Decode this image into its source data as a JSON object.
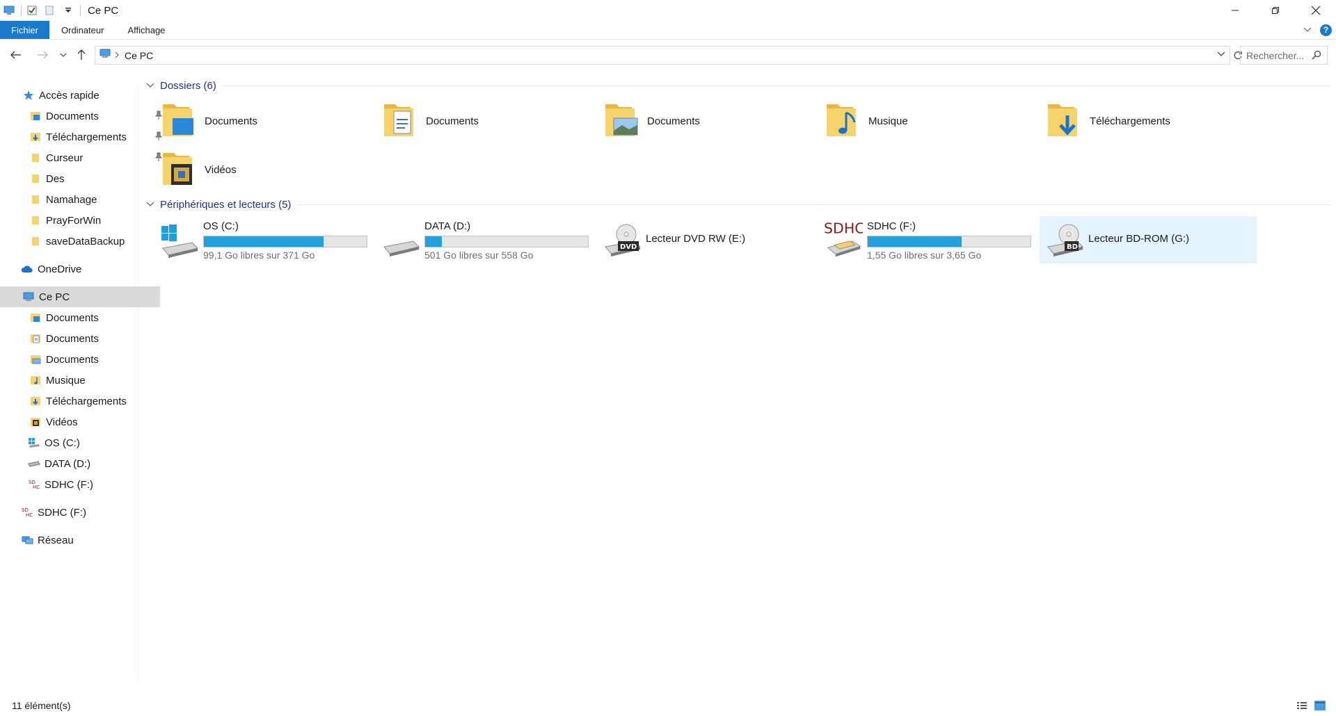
{
  "window": {
    "title": "Ce PC"
  },
  "ribbon": {
    "tabs": [
      {
        "label": "Fichier"
      },
      {
        "label": "Ordinateur"
      },
      {
        "label": "Affichage"
      }
    ],
    "help_label": "?"
  },
  "address": {
    "crumb": "Ce PC"
  },
  "search": {
    "placeholder": "Rechercher..."
  },
  "sidebar": {
    "quick_access": {
      "label": "Accès rapide",
      "items": [
        {
          "label": "Documents",
          "pinned": true
        },
        {
          "label": "Téléchargements",
          "pinned": true
        },
        {
          "label": "Curseur",
          "pinned": true
        },
        {
          "label": "Des",
          "pinned": false
        },
        {
          "label": "Namahage",
          "pinned": false
        },
        {
          "label": "PrayForWin",
          "pinned": false
        },
        {
          "label": "saveDataBackup",
          "pinned": false
        }
      ]
    },
    "onedrive": {
      "label": "OneDrive"
    },
    "this_pc": {
      "label": "Ce PC",
      "items": [
        {
          "label": "Documents"
        },
        {
          "label": "Documents"
        },
        {
          "label": "Documents"
        },
        {
          "label": "Musique"
        },
        {
          "label": "Téléchargements"
        },
        {
          "label": "Vidéos"
        },
        {
          "label": "OS (C:)"
        },
        {
          "label": "DATA (D:)"
        },
        {
          "label": "SDHC (F:)"
        }
      ]
    },
    "sdhc": {
      "label": "SDHC (F:)"
    },
    "network": {
      "label": "Réseau"
    }
  },
  "content": {
    "folders_header": "Dossiers (6)",
    "folders": [
      {
        "label": "Documents",
        "icon": "folder-documents-icon"
      },
      {
        "label": "Documents",
        "icon": "folder-documents-icon"
      },
      {
        "label": "Documents",
        "icon": "folder-pictures-icon"
      },
      {
        "label": "Musique",
        "icon": "folder-music-icon"
      },
      {
        "label": "Téléchargements",
        "icon": "folder-downloads-icon"
      },
      {
        "label": "Vidéos",
        "icon": "folder-videos-icon"
      }
    ],
    "drives_header": "Périphériques et lecteurs (5)",
    "drives": [
      {
        "label": "OS (C:)",
        "free": "99,1 Go libres sur 371 Go",
        "used_fraction": 0.733,
        "bar_color": "#26a0da"
      },
      {
        "label": "DATA (D:)",
        "free": "501 Go libres sur 558 Go",
        "used_fraction": 0.102,
        "bar_color": "#26a0da"
      },
      {
        "label": "Lecteur DVD RW (E:)",
        "icon_text": "DVD"
      },
      {
        "label": "SDHC (F:)",
        "free": "1,55 Go libres sur 3,65 Go",
        "used_fraction": 0.575,
        "bar_color": "#26a0da",
        "icon_text": "SDHC"
      },
      {
        "label": "Lecteur BD-ROM (G:)",
        "icon_text": "BD"
      }
    ]
  },
  "status": {
    "count": "11 élément(s)"
  },
  "colors": {
    "accent": "#1979ca",
    "bar": "#26a0da",
    "header": "#1e3287",
    "hover": "#e5f3ff",
    "folder": "#f7d36b"
  }
}
